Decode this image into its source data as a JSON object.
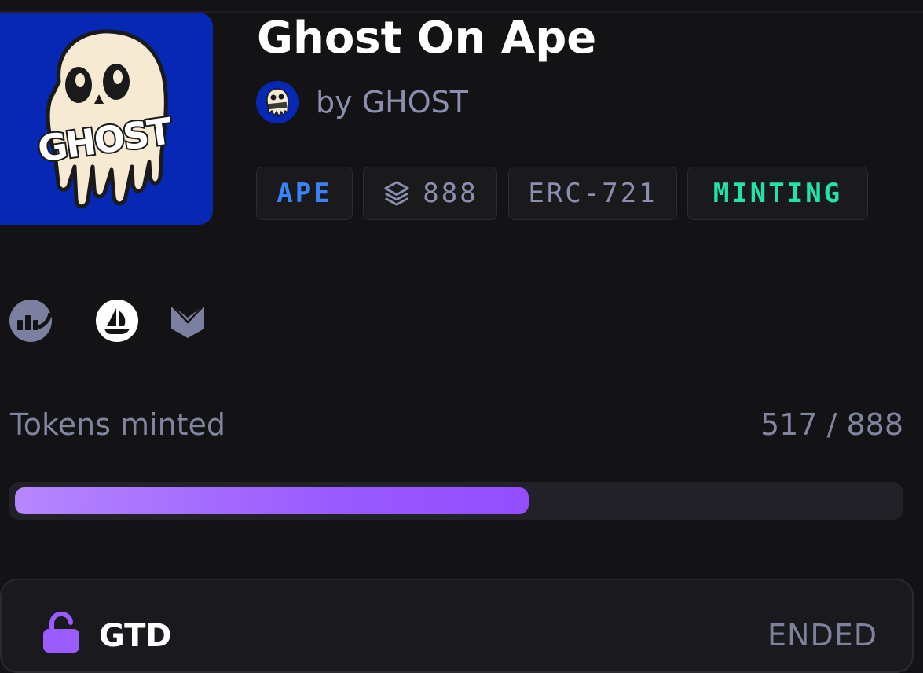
{
  "collection": {
    "title": "Ghost On Ape",
    "creator": "by GHOST",
    "cover_text": "GHOST",
    "cover_color": "#0628b4"
  },
  "tags": {
    "chain": "APE",
    "supply": "888",
    "standard": "ERC-721",
    "status": "MINTING"
  },
  "links": [
    {
      "icon": "chart-analytics-icon"
    },
    {
      "icon": "opensea-boat-icon"
    },
    {
      "icon": "magic-eden-icon"
    }
  ],
  "mint_progress": {
    "label": "Tokens minted",
    "count_text": "517 / 888",
    "minted": 517,
    "total": 888
  },
  "phase": {
    "name": "GTD",
    "status": "ENDED",
    "icon": "unlock-icon"
  },
  "colors": {
    "background": "#131315",
    "accent_purple": "#9a5bff",
    "status_green": "#22e3a8",
    "chain_blue": "#3b82f6"
  }
}
